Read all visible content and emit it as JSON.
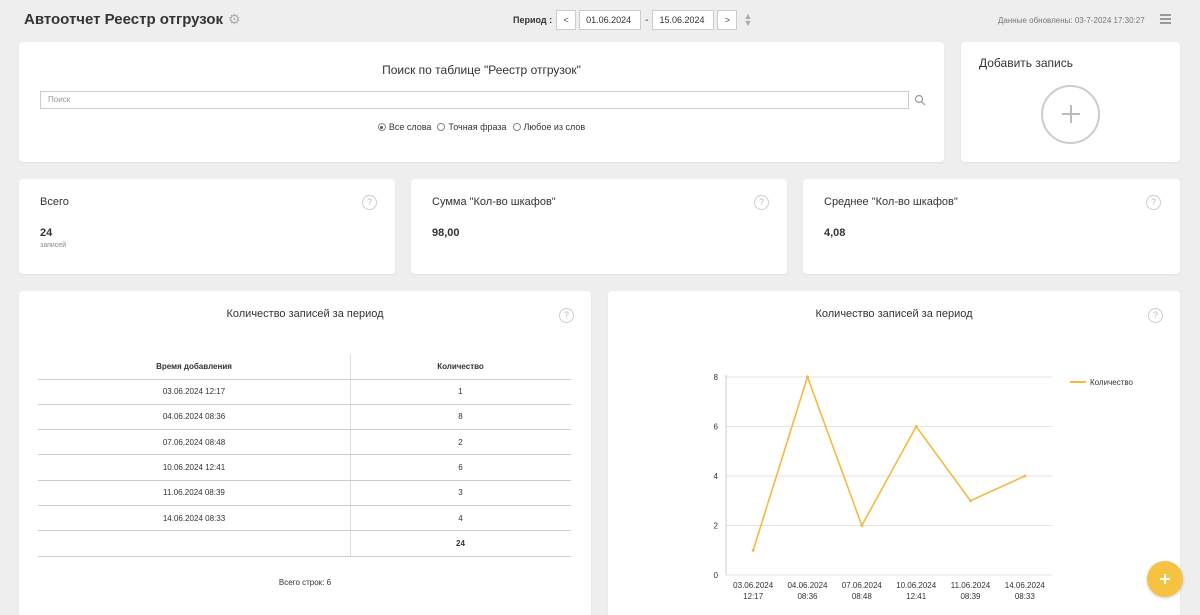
{
  "header": {
    "title": "Автоотчет Реестр отгрузок",
    "period_label": "Период :",
    "prev_label": "<",
    "date_from": "01.06.2024",
    "date_sep": "-",
    "date_to": "15.06.2024",
    "next_label": ">",
    "updated": "Данные обновлены: 03-7-2024 17:30:27"
  },
  "search": {
    "title": "Поиск по таблице \"Реестр отгрузок\"",
    "placeholder": "Поиск",
    "options": [
      "Все слова",
      "Точная фраза",
      "Любое из слов"
    ],
    "selected": "Все слова"
  },
  "add": {
    "title": "Добавить запись"
  },
  "stats": [
    {
      "title": "Всего",
      "value": "24",
      "sub": "записей"
    },
    {
      "title": "Сумма \"Кол-во шкафов\"",
      "value": "98,00"
    },
    {
      "title": "Среднее \"Кол-во шкафов\"",
      "value": "4,08"
    }
  ],
  "help_symbol": "?",
  "table_panel": {
    "title": "Количество записей за период",
    "columns": [
      "Время добавления",
      "Количество"
    ],
    "rows": [
      [
        "03.06.2024 12:17",
        "1"
      ],
      [
        "04.06.2024 08:36",
        "8"
      ],
      [
        "07.06.2024 08:48",
        "2"
      ],
      [
        "10.06.2024 12:41",
        "6"
      ],
      [
        "11.06.2024 08:39",
        "3"
      ],
      [
        "14.06.2024 08:33",
        "4"
      ]
    ],
    "total": "24",
    "total_rows": "Всего строк: 6"
  },
  "chart_panel": {
    "title": "Количество записей за период"
  },
  "chart_data": {
    "type": "line",
    "categories": [
      "03.06.2024 12:17",
      "04.06.2024 08:36",
      "07.06.2024 08:48",
      "10.06.2024 12:41",
      "11.06.2024 08:39",
      "14.06.2024 08:33"
    ],
    "series": [
      {
        "name": "Количество",
        "values": [
          1,
          8,
          2,
          6,
          3,
          4
        ],
        "color": "#f5b942"
      }
    ],
    "ylim": [
      0,
      8
    ],
    "yticks": [
      0,
      2,
      4,
      6,
      8
    ],
    "grid": true,
    "legend": "right"
  },
  "colors": {
    "accent": "#f5c242",
    "line": "#f5b942"
  }
}
